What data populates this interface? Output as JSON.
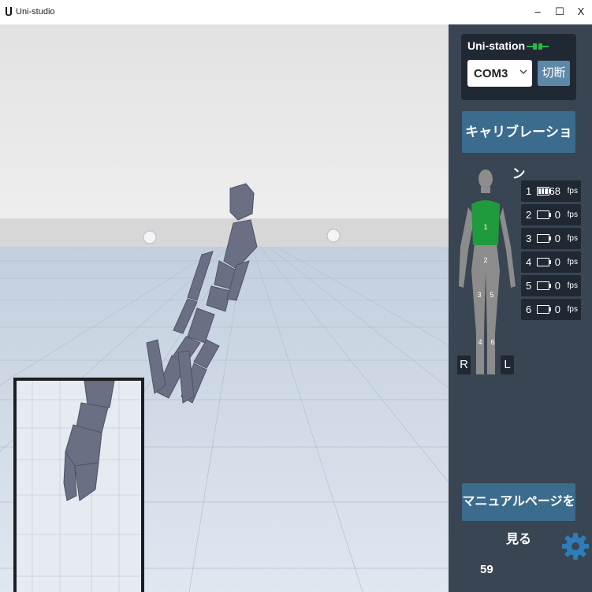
{
  "window": {
    "title": "Uni-studio",
    "minimize_label": "–",
    "maximize_label": "☐",
    "close_label": "X"
  },
  "station": {
    "title": "Uni-station",
    "icon": "plug-connected-icon",
    "port_value": "COM3",
    "disconnect_label": "切断"
  },
  "calibration_label": "キャリブレーション",
  "body_map": {
    "segments": [
      "1",
      "2",
      "3",
      "5",
      "4",
      "6"
    ],
    "highlight_color": "#1f9a3c",
    "right_label": "R",
    "left_label": "L"
  },
  "sensors": [
    {
      "id": "1",
      "fps": "68",
      "unit": "fps",
      "battery": "full"
    },
    {
      "id": "2",
      "fps": "0",
      "unit": "fps",
      "battery": "empty"
    },
    {
      "id": "3",
      "fps": "0",
      "unit": "fps",
      "battery": "empty"
    },
    {
      "id": "4",
      "fps": "0",
      "unit": "fps",
      "battery": "empty"
    },
    {
      "id": "5",
      "fps": "0",
      "unit": "fps",
      "battery": "empty"
    },
    {
      "id": "6",
      "fps": "0",
      "unit": "fps",
      "battery": "empty"
    }
  ],
  "manual_label": "マニュアルページを見る",
  "frame_rate": "59",
  "colors": {
    "panel_bg": "#394552",
    "button_bg": "#3b6b8d",
    "accent_green": "#1f9a3c"
  }
}
